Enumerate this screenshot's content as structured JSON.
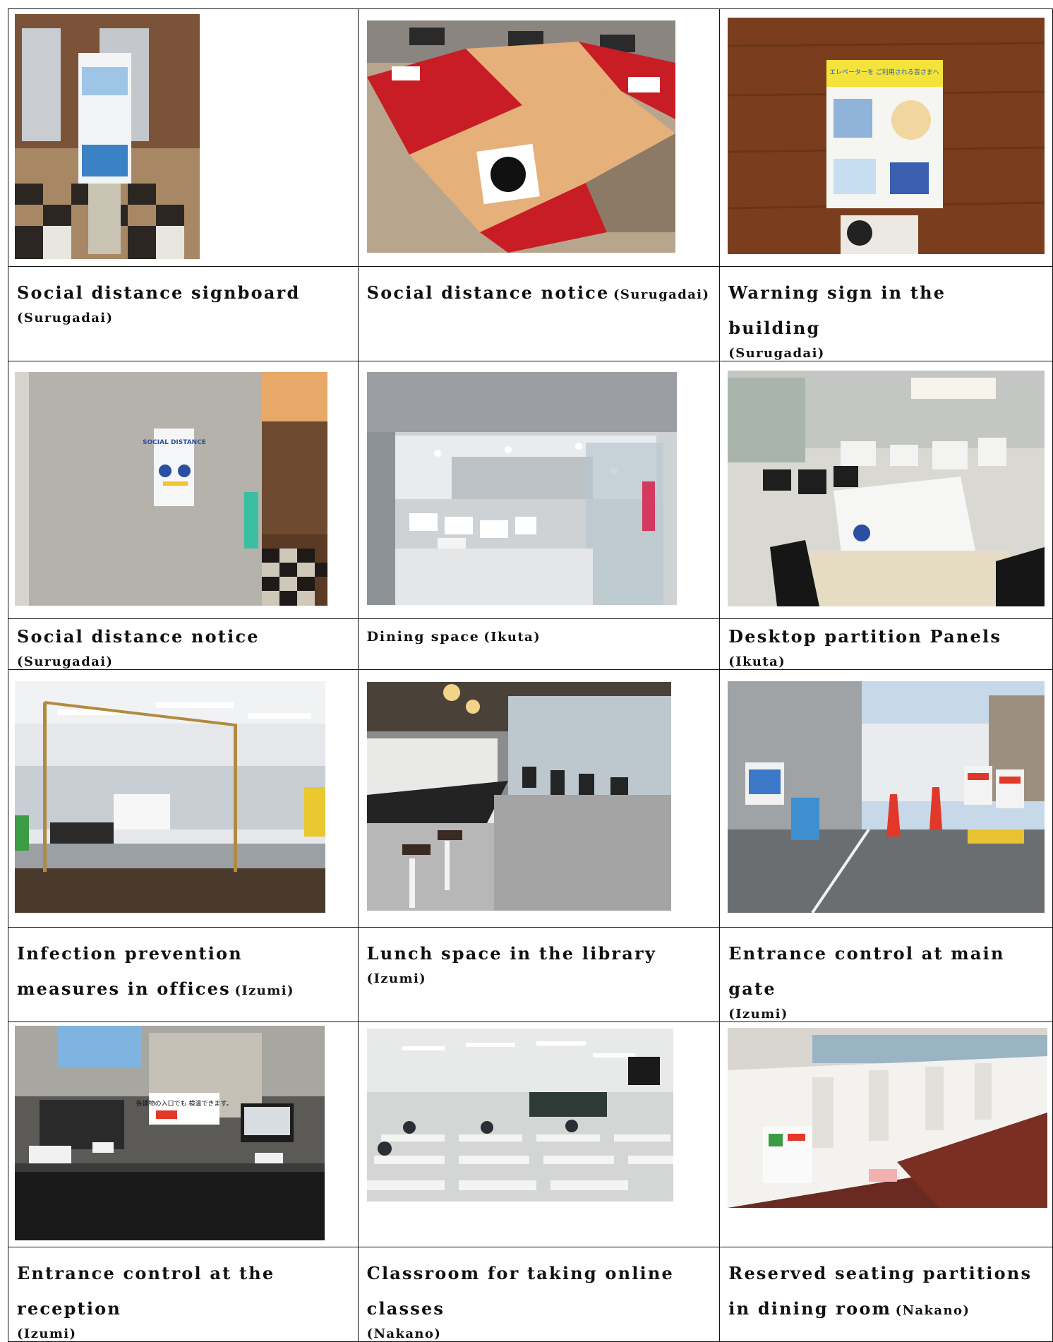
{
  "rows": [
    [
      {
        "title": "Social distance signboard",
        "location": "(Surugadai)",
        "photo_alt": "photo"
      },
      {
        "title": "Social distance notice",
        "location": "(Surugadai)",
        "photo_alt": "photo"
      },
      {
        "title": "Warning sign in the building",
        "location": "(Surugadai)",
        "photo_alt": "photo"
      }
    ],
    [
      {
        "title": "Social distance notice",
        "location": "(Surugadai)",
        "photo_alt": "photo"
      },
      {
        "title": "Dining space",
        "location": "(Ikuta)",
        "photo_alt": "photo"
      },
      {
        "title": "Desktop partition Panels",
        "location": "(Ikuta)",
        "photo_alt": "photo"
      }
    ],
    [
      {
        "title": "Infection prevention measures in offices",
        "location": "(Izumi)",
        "photo_alt": "photo"
      },
      {
        "title": "Lunch space in the library",
        "location": "(Izumi)",
        "photo_alt": "photo"
      },
      {
        "title": "Entrance control at main gate",
        "location": "(Izumi)",
        "photo_alt": "photo"
      }
    ],
    [
      {
        "title": "Entrance control at the reception",
        "location": "(Izumi)",
        "photo_alt": "photo"
      },
      {
        "title": "Classroom for taking online classes",
        "location": "(Nakano)",
        "photo_alt": "photo"
      },
      {
        "title": "Reserved seating partitions in dining room",
        "location": "(Nakano)",
        "photo_alt": "photo"
      }
    ]
  ],
  "photo_text": {
    "poster_social": "SOCIAL DISTANCE",
    "elevator_poster": "エレベーターを ご利用される皆さまへ",
    "reception_sign": "各建物の入口でも 検温できます。"
  },
  "colors": {
    "border": "#111111",
    "text": "#111111",
    "red_tile": "#c81d25",
    "wood": "#7a3e1e"
  }
}
